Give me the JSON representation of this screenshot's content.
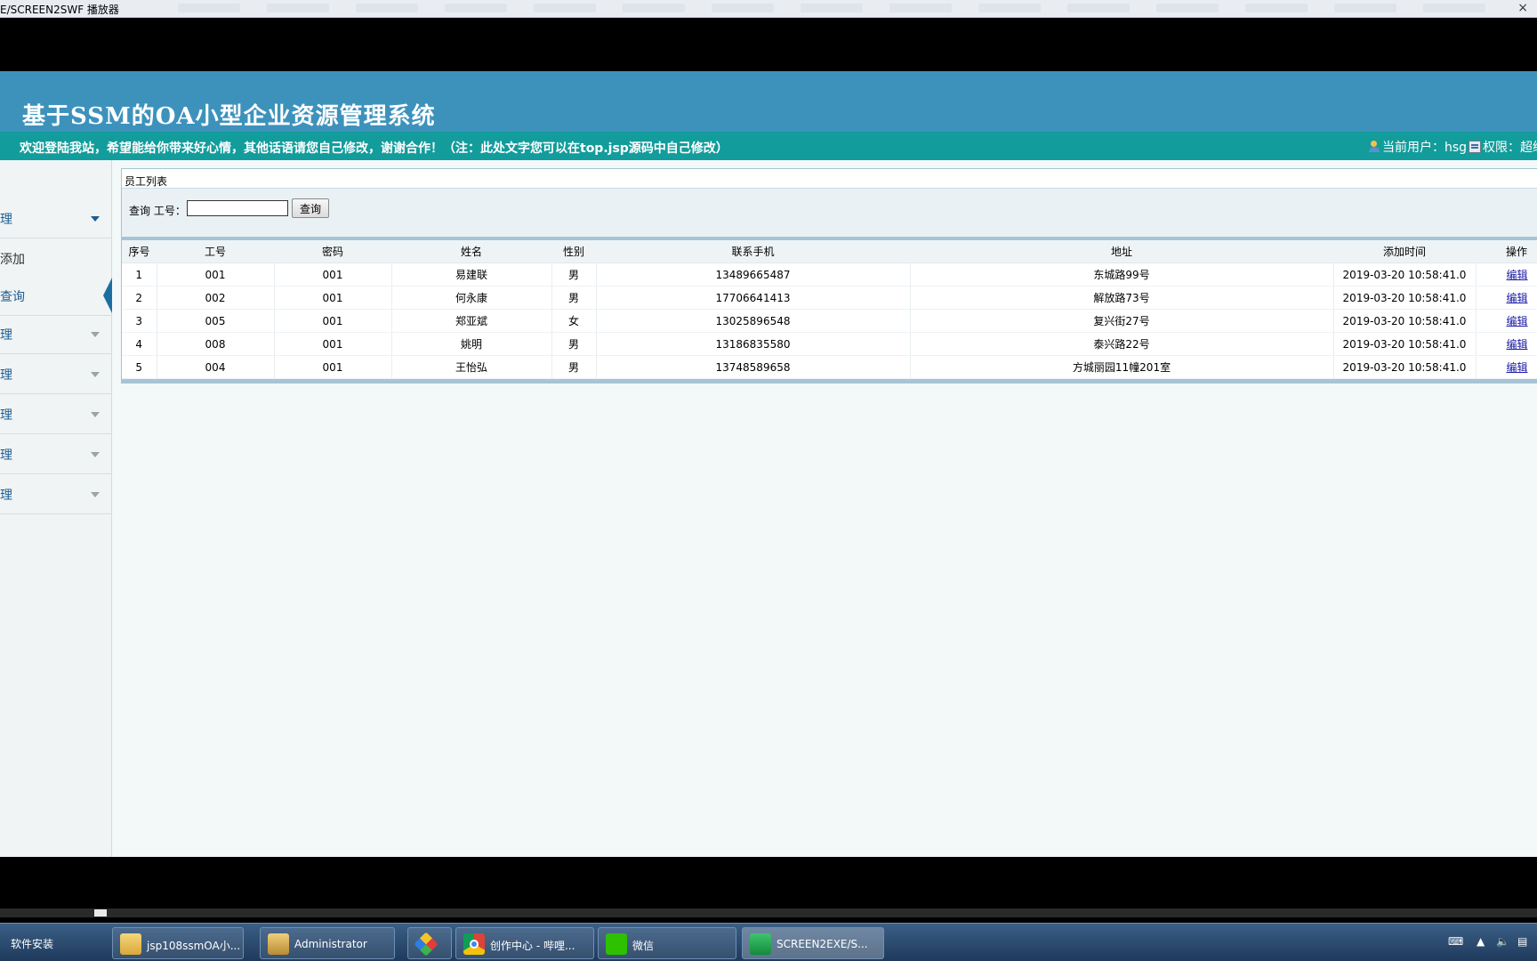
{
  "player": {
    "title": "E/SCREEN2SWF 播放器",
    "close_glyph": "×"
  },
  "site": {
    "title": "基于SSM的OA小型企业资源管理系统",
    "notice": "欢迎登陆我站，希望能给你带来好心情，其他话语请您自己修改，谢谢合作！（注：此处文字您可以在top.jsp源码中自己修改）",
    "current_user_label": "当前用户：hsg",
    "role_label": "权限：超级"
  },
  "sidebar": {
    "items": [
      {
        "label": "理",
        "open": true
      },
      {
        "label": "理",
        "open": false
      },
      {
        "label": "理",
        "open": false
      },
      {
        "label": "理",
        "open": false
      },
      {
        "label": "理",
        "open": false
      },
      {
        "label": "理",
        "open": false
      }
    ],
    "subitems": [
      {
        "label": "添加",
        "active": false
      },
      {
        "label": "查询",
        "active": true
      }
    ]
  },
  "panel": {
    "title": "员工列表",
    "search_label": "查询 工号：",
    "search_value": "",
    "search_button": "查询"
  },
  "table": {
    "columns": [
      "序号",
      "工号",
      "密码",
      "姓名",
      "性别",
      "联系手机",
      "地址",
      "添加时间",
      "操作"
    ],
    "rows": [
      [
        "1",
        "001",
        "001",
        "易建联",
        "男",
        "13489665487",
        "东城路99号",
        "2019-03-20 10:58:41.0",
        "编辑"
      ],
      [
        "2",
        "002",
        "001",
        "何永康",
        "男",
        "17706641413",
        "解放路73号",
        "2019-03-20 10:58:41.0",
        "编辑"
      ],
      [
        "3",
        "005",
        "001",
        "郑亚斌",
        "女",
        "13025896548",
        "复兴街27号",
        "2019-03-20 10:58:41.0",
        "编辑"
      ],
      [
        "4",
        "008",
        "001",
        "姚明",
        "男",
        "13186835580",
        "泰兴路22号",
        "2019-03-20 10:58:41.0",
        "编辑"
      ],
      [
        "5",
        "004",
        "001",
        "王怡弘",
        "男",
        "13748589658",
        "方城丽园11幢201室",
        "2019-03-20 10:58:41.0",
        "编辑"
      ]
    ]
  },
  "taskbar": {
    "start_label": "软件安装",
    "buttons": [
      {
        "label": "jsp108ssmOA小...",
        "icon": "folder-icon"
      },
      {
        "label": "Administrator",
        "icon": "admin-folder-icon"
      },
      {
        "label": "",
        "icon": "colorful-diamond-icon"
      },
      {
        "label": "创作中心 - 哔哩...",
        "icon": "chrome-icon"
      },
      {
        "label": "微信",
        "icon": "wechat-icon"
      },
      {
        "label": "SCREEN2EXE/S...",
        "icon": "screen2exe-icon"
      }
    ],
    "tray": {
      "keyboard_icon": "keyboard-icon",
      "volume_icon": "volume-icon",
      "network_icon": "network-icon"
    }
  },
  "colors": {
    "header": "#3d92bc",
    "notice_bar": "#139c9c",
    "link": "#1a1aa6"
  }
}
